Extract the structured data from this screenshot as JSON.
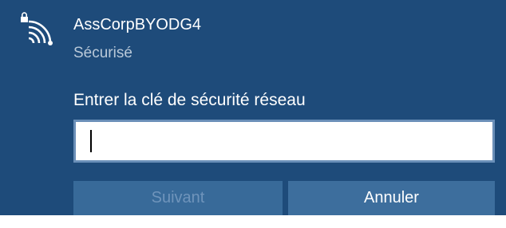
{
  "network": {
    "name": "AssCorpBYODG4",
    "status": "Sécurisé",
    "icon": "wifi-secured-icon"
  },
  "prompt": {
    "label": "Entrer la clé de sécurité réseau"
  },
  "key_input": {
    "value": "",
    "placeholder": ""
  },
  "buttons": {
    "next_label": "Suivant",
    "next_enabled": false,
    "cancel_label": "Annuler"
  },
  "colors": {
    "background": "#1e4b7a",
    "status_text": "#b9c9d9",
    "button_bg": "#3d6e9d",
    "disabled_text": "#6f94bb",
    "input_border": "#6a8fb8"
  }
}
